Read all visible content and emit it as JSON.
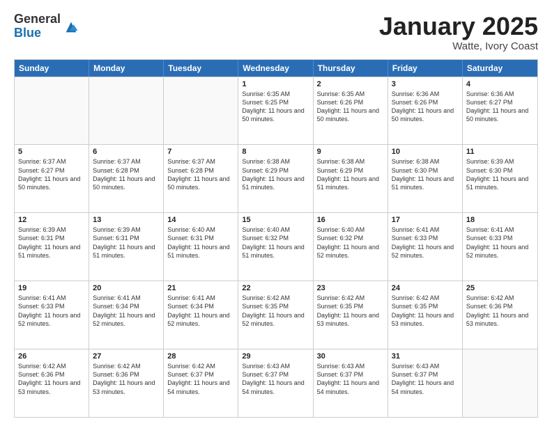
{
  "logo": {
    "general": "General",
    "blue": "Blue"
  },
  "title": {
    "month": "January 2025",
    "location": "Watte, Ivory Coast"
  },
  "header": {
    "days": [
      "Sunday",
      "Monday",
      "Tuesday",
      "Wednesday",
      "Thursday",
      "Friday",
      "Saturday"
    ]
  },
  "weeks": [
    [
      {
        "day": "",
        "sunrise": "",
        "sunset": "",
        "daylight": ""
      },
      {
        "day": "",
        "sunrise": "",
        "sunset": "",
        "daylight": ""
      },
      {
        "day": "",
        "sunrise": "",
        "sunset": "",
        "daylight": ""
      },
      {
        "day": "1",
        "sunrise": "Sunrise: 6:35 AM",
        "sunset": "Sunset: 6:25 PM",
        "daylight": "Daylight: 11 hours and 50 minutes."
      },
      {
        "day": "2",
        "sunrise": "Sunrise: 6:35 AM",
        "sunset": "Sunset: 6:26 PM",
        "daylight": "Daylight: 11 hours and 50 minutes."
      },
      {
        "day": "3",
        "sunrise": "Sunrise: 6:36 AM",
        "sunset": "Sunset: 6:26 PM",
        "daylight": "Daylight: 11 hours and 50 minutes."
      },
      {
        "day": "4",
        "sunrise": "Sunrise: 6:36 AM",
        "sunset": "Sunset: 6:27 PM",
        "daylight": "Daylight: 11 hours and 50 minutes."
      }
    ],
    [
      {
        "day": "5",
        "sunrise": "Sunrise: 6:37 AM",
        "sunset": "Sunset: 6:27 PM",
        "daylight": "Daylight: 11 hours and 50 minutes."
      },
      {
        "day": "6",
        "sunrise": "Sunrise: 6:37 AM",
        "sunset": "Sunset: 6:28 PM",
        "daylight": "Daylight: 11 hours and 50 minutes."
      },
      {
        "day": "7",
        "sunrise": "Sunrise: 6:37 AM",
        "sunset": "Sunset: 6:28 PM",
        "daylight": "Daylight: 11 hours and 50 minutes."
      },
      {
        "day": "8",
        "sunrise": "Sunrise: 6:38 AM",
        "sunset": "Sunset: 6:29 PM",
        "daylight": "Daylight: 11 hours and 51 minutes."
      },
      {
        "day": "9",
        "sunrise": "Sunrise: 6:38 AM",
        "sunset": "Sunset: 6:29 PM",
        "daylight": "Daylight: 11 hours and 51 minutes."
      },
      {
        "day": "10",
        "sunrise": "Sunrise: 6:38 AM",
        "sunset": "Sunset: 6:30 PM",
        "daylight": "Daylight: 11 hours and 51 minutes."
      },
      {
        "day": "11",
        "sunrise": "Sunrise: 6:39 AM",
        "sunset": "Sunset: 6:30 PM",
        "daylight": "Daylight: 11 hours and 51 minutes."
      }
    ],
    [
      {
        "day": "12",
        "sunrise": "Sunrise: 6:39 AM",
        "sunset": "Sunset: 6:31 PM",
        "daylight": "Daylight: 11 hours and 51 minutes."
      },
      {
        "day": "13",
        "sunrise": "Sunrise: 6:39 AM",
        "sunset": "Sunset: 6:31 PM",
        "daylight": "Daylight: 11 hours and 51 minutes."
      },
      {
        "day": "14",
        "sunrise": "Sunrise: 6:40 AM",
        "sunset": "Sunset: 6:31 PM",
        "daylight": "Daylight: 11 hours and 51 minutes."
      },
      {
        "day": "15",
        "sunrise": "Sunrise: 6:40 AM",
        "sunset": "Sunset: 6:32 PM",
        "daylight": "Daylight: 11 hours and 51 minutes."
      },
      {
        "day": "16",
        "sunrise": "Sunrise: 6:40 AM",
        "sunset": "Sunset: 6:32 PM",
        "daylight": "Daylight: 11 hours and 52 minutes."
      },
      {
        "day": "17",
        "sunrise": "Sunrise: 6:41 AM",
        "sunset": "Sunset: 6:33 PM",
        "daylight": "Daylight: 11 hours and 52 minutes."
      },
      {
        "day": "18",
        "sunrise": "Sunrise: 6:41 AM",
        "sunset": "Sunset: 6:33 PM",
        "daylight": "Daylight: 11 hours and 52 minutes."
      }
    ],
    [
      {
        "day": "19",
        "sunrise": "Sunrise: 6:41 AM",
        "sunset": "Sunset: 6:33 PM",
        "daylight": "Daylight: 11 hours and 52 minutes."
      },
      {
        "day": "20",
        "sunrise": "Sunrise: 6:41 AM",
        "sunset": "Sunset: 6:34 PM",
        "daylight": "Daylight: 11 hours and 52 minutes."
      },
      {
        "day": "21",
        "sunrise": "Sunrise: 6:41 AM",
        "sunset": "Sunset: 6:34 PM",
        "daylight": "Daylight: 11 hours and 52 minutes."
      },
      {
        "day": "22",
        "sunrise": "Sunrise: 6:42 AM",
        "sunset": "Sunset: 6:35 PM",
        "daylight": "Daylight: 11 hours and 52 minutes."
      },
      {
        "day": "23",
        "sunrise": "Sunrise: 6:42 AM",
        "sunset": "Sunset: 6:35 PM",
        "daylight": "Daylight: 11 hours and 53 minutes."
      },
      {
        "day": "24",
        "sunrise": "Sunrise: 6:42 AM",
        "sunset": "Sunset: 6:35 PM",
        "daylight": "Daylight: 11 hours and 53 minutes."
      },
      {
        "day": "25",
        "sunrise": "Sunrise: 6:42 AM",
        "sunset": "Sunset: 6:36 PM",
        "daylight": "Daylight: 11 hours and 53 minutes."
      }
    ],
    [
      {
        "day": "26",
        "sunrise": "Sunrise: 6:42 AM",
        "sunset": "Sunset: 6:36 PM",
        "daylight": "Daylight: 11 hours and 53 minutes."
      },
      {
        "day": "27",
        "sunrise": "Sunrise: 6:42 AM",
        "sunset": "Sunset: 6:36 PM",
        "daylight": "Daylight: 11 hours and 53 minutes."
      },
      {
        "day": "28",
        "sunrise": "Sunrise: 6:42 AM",
        "sunset": "Sunset: 6:37 PM",
        "daylight": "Daylight: 11 hours and 54 minutes."
      },
      {
        "day": "29",
        "sunrise": "Sunrise: 6:43 AM",
        "sunset": "Sunset: 6:37 PM",
        "daylight": "Daylight: 11 hours and 54 minutes."
      },
      {
        "day": "30",
        "sunrise": "Sunrise: 6:43 AM",
        "sunset": "Sunset: 6:37 PM",
        "daylight": "Daylight: 11 hours and 54 minutes."
      },
      {
        "day": "31",
        "sunrise": "Sunrise: 6:43 AM",
        "sunset": "Sunset: 6:37 PM",
        "daylight": "Daylight: 11 hours and 54 minutes."
      },
      {
        "day": "",
        "sunrise": "",
        "sunset": "",
        "daylight": ""
      }
    ]
  ]
}
